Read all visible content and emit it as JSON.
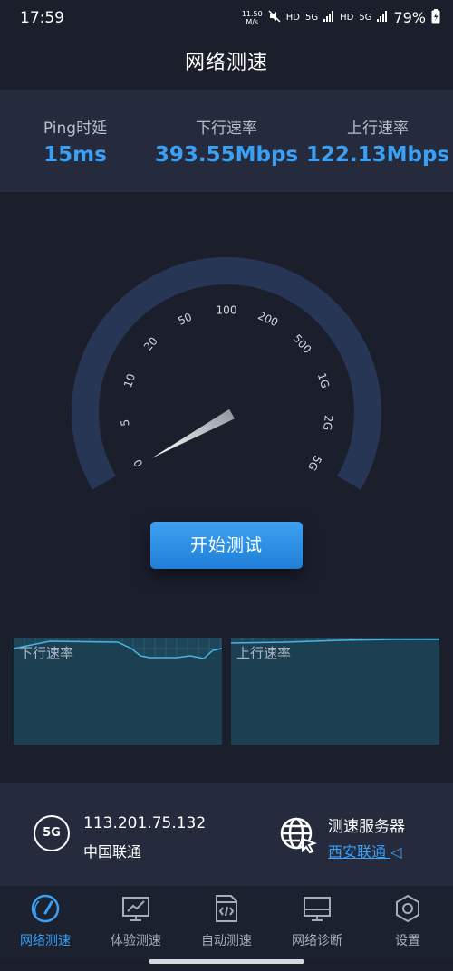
{
  "status_bar": {
    "time": "17:59",
    "net_speed_value": "11.50",
    "net_speed_unit": "M/s",
    "hd1": "HD",
    "sig1": "5G",
    "hd2": "HD",
    "sig2": "5G",
    "battery": "79%"
  },
  "page_title": "网络测速",
  "stats": {
    "ping": {
      "label": "Ping时延",
      "value": "15ms"
    },
    "download": {
      "label": "下行速率",
      "value": "393.55Mbps"
    },
    "upload": {
      "label": "上行速率",
      "value": "122.13Mbps"
    }
  },
  "gauge": {
    "ticks": [
      "0",
      "5",
      "10",
      "20",
      "50",
      "100",
      "200",
      "500",
      "1G",
      "2G",
      "5G"
    ],
    "needle_value": "0"
  },
  "start_button": "开始测试",
  "graphs": {
    "download_label": "下行速率",
    "upload_label": "上行速率"
  },
  "network": {
    "badge": "5G",
    "ip": "113.201.75.132",
    "carrier": "中国联通",
    "server_label": "测速服务器",
    "server_name": "西安联通"
  },
  "tabs": [
    {
      "label": "网络测速",
      "icon": "speedometer-icon",
      "active": true
    },
    {
      "label": "体验测速",
      "icon": "monitor-chart-icon",
      "active": false
    },
    {
      "label": "自动测速",
      "icon": "code-file-icon",
      "active": false
    },
    {
      "label": "网络诊断",
      "icon": "monitor-icon",
      "active": false
    },
    {
      "label": "设置",
      "icon": "gear-icon",
      "active": false
    }
  ],
  "colors": {
    "accent": "#3aa0f5",
    "background": "#1b1f2c",
    "panel": "#252b3c",
    "gauge_track": "#283656"
  }
}
